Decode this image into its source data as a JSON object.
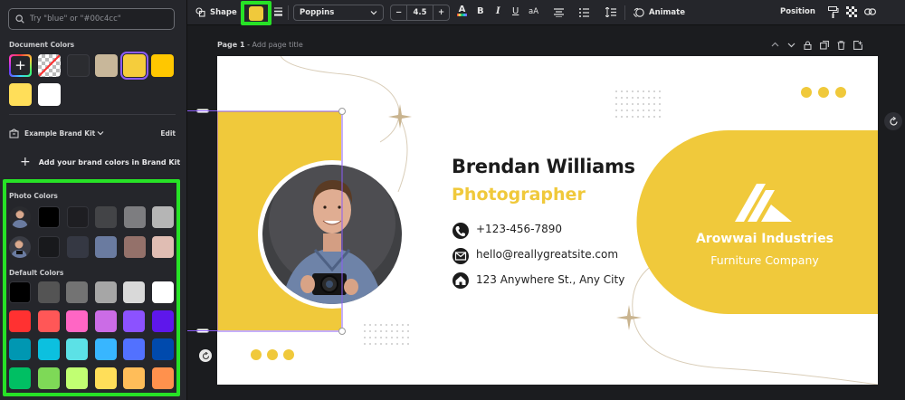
{
  "search": {
    "placeholder": "Try \"blue\" or \"#00c4cc\""
  },
  "document_colors": {
    "title": "Document Colors",
    "swatches": [
      "#2b2c30",
      "#c8b79a",
      "#f5cd3c",
      "#ffc700",
      "#ffde59",
      "#ffffff"
    ]
  },
  "brand_kit": {
    "name": "Example Brand Kit",
    "edit_label": "Edit",
    "add_label": "Add your brand colors in Brand Kit"
  },
  "photo_colors": {
    "title": "Photo Colors",
    "row1": [
      "#000000",
      "#1e1e22",
      "#434447",
      "#7d7d80",
      "#b5b5b5"
    ],
    "row2": [
      "#18191c",
      "#353843",
      "#6a7ba0",
      "#94716a",
      "#e0bdb3"
    ]
  },
  "default_colors": {
    "title": "Default Colors",
    "rows": [
      [
        "#000000",
        "#545454",
        "#737373",
        "#a6a6a6",
        "#d9d9d9",
        "#ffffff"
      ],
      [
        "#ff3131",
        "#ff5757",
        "#ff66c4",
        "#cb6ce6",
        "#8c52ff",
        "#5e17eb"
      ],
      [
        "#0097b2",
        "#0cc0df",
        "#5ce1e6",
        "#38b6ff",
        "#5271ff",
        "#004aad"
      ],
      [
        "#00bf63",
        "#7ed957",
        "#c1ff72",
        "#ffde59",
        "#ffbd59",
        "#ff914d"
      ]
    ]
  },
  "toolbar": {
    "shape_label": "Shape",
    "selected_color": "#f0c93b",
    "font": "Poppins",
    "font_size": "4.5",
    "minus": "−",
    "plus": "+",
    "bold": "B",
    "italic": "I",
    "underline": "U",
    "case": "aA",
    "animate_label": "Animate",
    "position_label": "Position"
  },
  "page": {
    "label": "Page 1",
    "title_placeholder": "Add page title"
  },
  "card": {
    "name": "Brendan Williams",
    "role": "Photographer",
    "phone": "+123-456-7890",
    "email": "hello@reallygreatsite.com",
    "address": "123 Anywhere St., Any City",
    "company": "Arowwai Industries",
    "company_sub": "Furniture Company",
    "accent": "#f0c93b"
  },
  "colors": {
    "highlight": "#27e226",
    "selection": "#8b5cf6"
  }
}
